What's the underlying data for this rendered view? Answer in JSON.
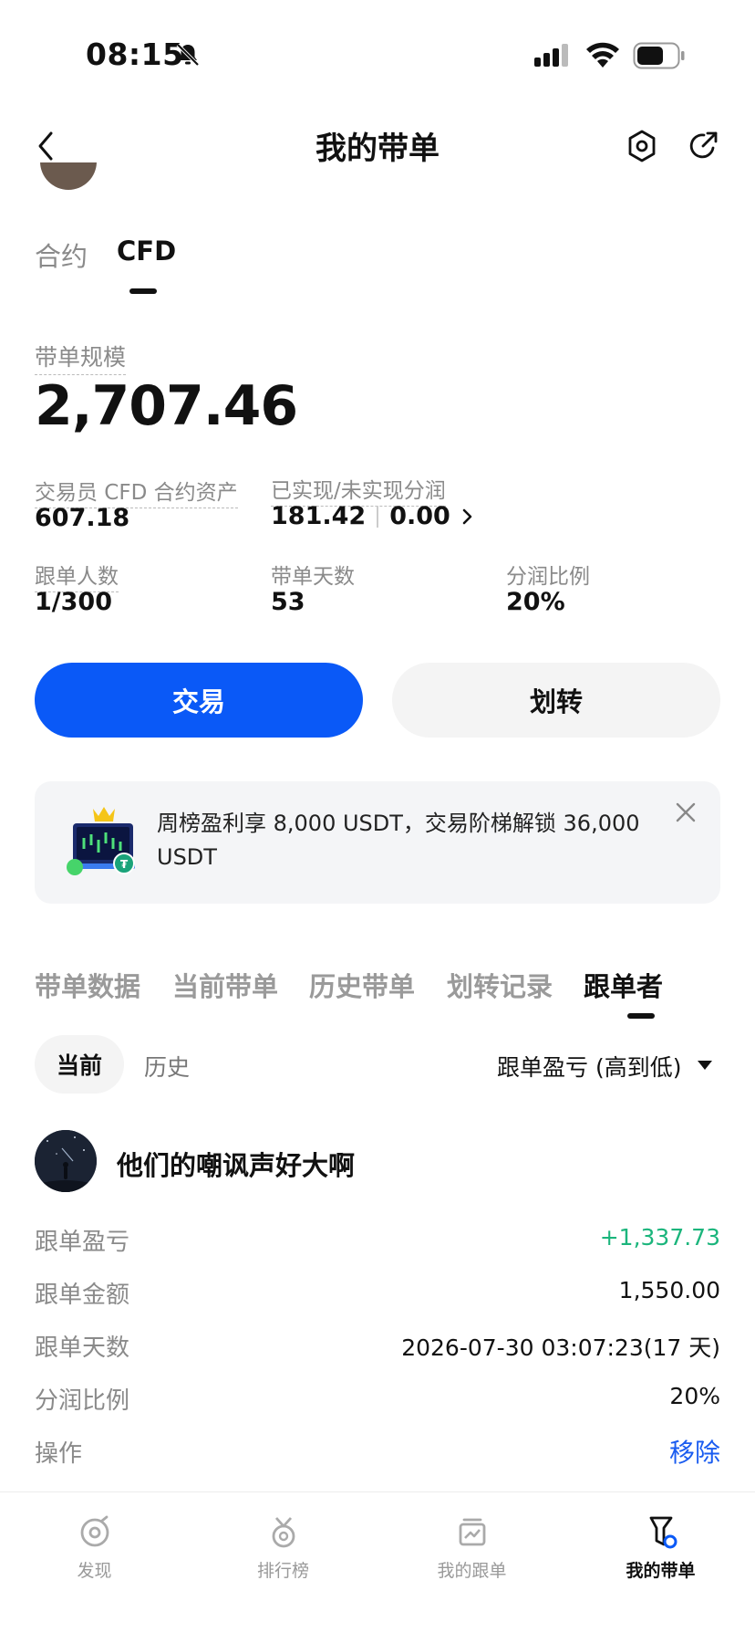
{
  "status_bar": {
    "time": "08:15"
  },
  "header": {
    "title": "我的带单"
  },
  "top_tabs": [
    {
      "label": "合约",
      "active": false
    },
    {
      "label": "CFD",
      "active": true
    }
  ],
  "scale": {
    "label": "带单规模",
    "value": "2,707.46"
  },
  "stats": {
    "assets_label": "交易员 CFD 合约资产",
    "assets_value": "607.18",
    "profit_label": "已实现/未实现分润",
    "realized": "181.42",
    "unrealized": "0.00",
    "followers_label": "跟单人数",
    "followers_value": "1/300",
    "days_label": "带单天数",
    "days_value": "53",
    "share_label": "分润比例",
    "share_value": "20%"
  },
  "buttons": {
    "trade": "交易",
    "transfer": "划转"
  },
  "banner": {
    "text": "周榜盈利享 8,000 USDT，交易阶梯解锁 36,000 USDT"
  },
  "section_tabs": [
    {
      "label": "带单数据",
      "active": false
    },
    {
      "label": "当前带单",
      "active": false
    },
    {
      "label": "历史带单",
      "active": false
    },
    {
      "label": "划转记录",
      "active": false
    },
    {
      "label": "跟单者",
      "active": true
    }
  ],
  "filter": {
    "current": "当前",
    "history": "历史",
    "sort": "跟单盈亏 (高到低)"
  },
  "follower": {
    "name": "他们的嘲讽声好大啊",
    "pnl_label": "跟单盈亏",
    "pnl_value": "+1,337.73",
    "amount_label": "跟单金额",
    "amount_value": "1,550.00",
    "days_label": "跟单天数",
    "days_value": "2026-07-30 03:07:23(17 天)",
    "share_label": "分润比例",
    "share_value": "20%",
    "action_label": "操作",
    "action_value": "移除"
  },
  "bottom_nav": [
    {
      "label": "发现",
      "icon": "discover-icon",
      "active": false
    },
    {
      "label": "排行榜",
      "icon": "medal-icon",
      "active": false
    },
    {
      "label": "我的跟单",
      "icon": "chart-icon",
      "active": false
    },
    {
      "label": "我的带单",
      "icon": "flag-icon",
      "active": true
    }
  ],
  "colors": {
    "primary": "#0a59f7",
    "profit": "#1bb57c",
    "link": "#1a5cf0"
  }
}
